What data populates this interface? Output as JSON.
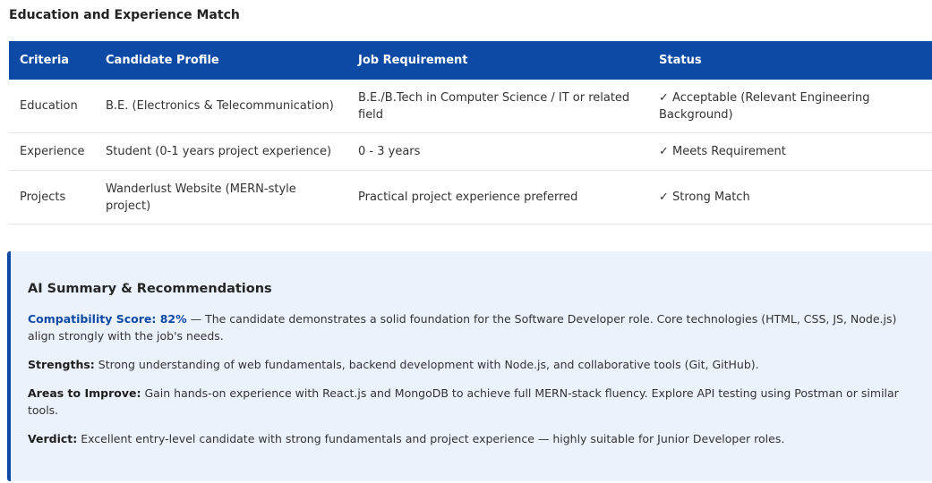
{
  "section": {
    "title": "Education and Experience Match"
  },
  "table": {
    "headers": [
      "Criteria",
      "Candidate Profile",
      "Job Requirement",
      "Status"
    ],
    "rows": [
      {
        "criteria": "Education",
        "candidate": "B.E. (Electronics & Telecommunication)",
        "requirement": "B.E./B.Tech in Computer Science / IT or related field",
        "status": "✓ Acceptable (Relevant Engineering Background)"
      },
      {
        "criteria": "Experience",
        "candidate": "Student (0-1 years project experience)",
        "requirement": "0 - 3 years",
        "status": "✓ Meets Requirement"
      },
      {
        "criteria": "Projects",
        "candidate": "Wanderlust Website (MERN-style project)",
        "requirement": "Practical project experience preferred",
        "status": "✓ Strong Match"
      }
    ]
  },
  "summary": {
    "title": "AI Summary & Recommendations",
    "score_label": "Compatibility Score: 82%",
    "score_text": " — The candidate demonstrates a solid foundation for the Software Developer role. Core technologies (HTML, CSS, JS, Node.js) align strongly with the job's needs.",
    "strengths_label": "Strengths:",
    "strengths_text": " Strong understanding of web fundamentals, backend development with Node.js, and collaborative tools (Git, GitHub).",
    "improve_label": "Areas to Improve:",
    "improve_text": " Gain hands-on experience with React.js and MongoDB to achieve full MERN-stack fluency. Explore API testing using Postman or similar tools.",
    "verdict_label": "Verdict:",
    "verdict_text": " Excellent entry-level candidate with strong fundamentals and project experience — highly suitable for Junior Developer roles."
  },
  "colors": {
    "header_bg": "#0c4aa6",
    "summary_bg": "#ebf2fc",
    "accent": "#0c4aa6"
  }
}
